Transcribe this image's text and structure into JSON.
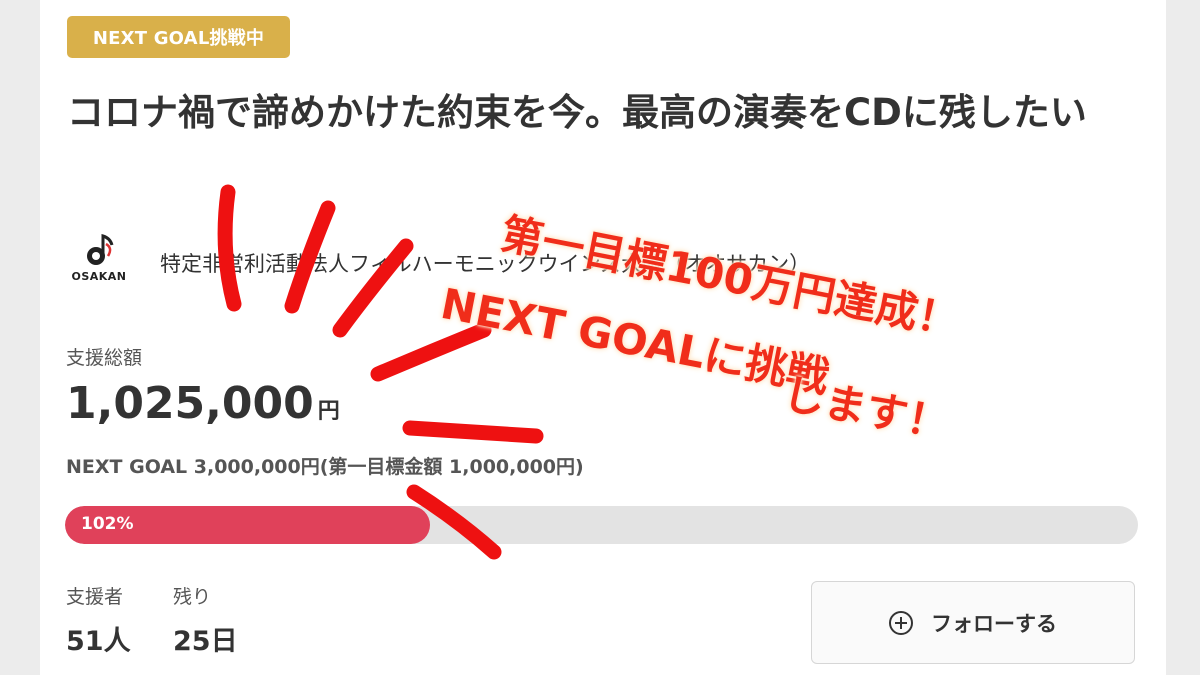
{
  "badge": "NEXT GOAL挑戦中",
  "title": "コロナ禍で諦めかけた約束を今。最高の演奏をCDに残したい",
  "organization": {
    "logo_text": "OSAKAN",
    "name": "特定非営利活動法人フィルハーモニックウインズ大阪（オオサカン）"
  },
  "funding": {
    "total_label": "支援総額",
    "total_amount": "1,025,000",
    "currency_unit": "円",
    "goal_text": "NEXT GOAL 3,000,000円(第一目標金額 1,000,000円)",
    "progress_label": "102%",
    "progress_fraction_of_bar": 0.34
  },
  "stats": {
    "supporters_label": "支援者",
    "supporters_value": "51人",
    "remaining_label": "残り",
    "remaining_value": "25日"
  },
  "follow_button": {
    "label": "フォローする",
    "icon": "plus-circle-icon"
  },
  "overlay": {
    "line1": "第一目標100万円達成！",
    "line2": "NEXT GOALに挑戦",
    "line3": "します！",
    "color": "#f02d1a"
  },
  "colors": {
    "badge": "#d9b04a",
    "progress": "#e0415a"
  }
}
